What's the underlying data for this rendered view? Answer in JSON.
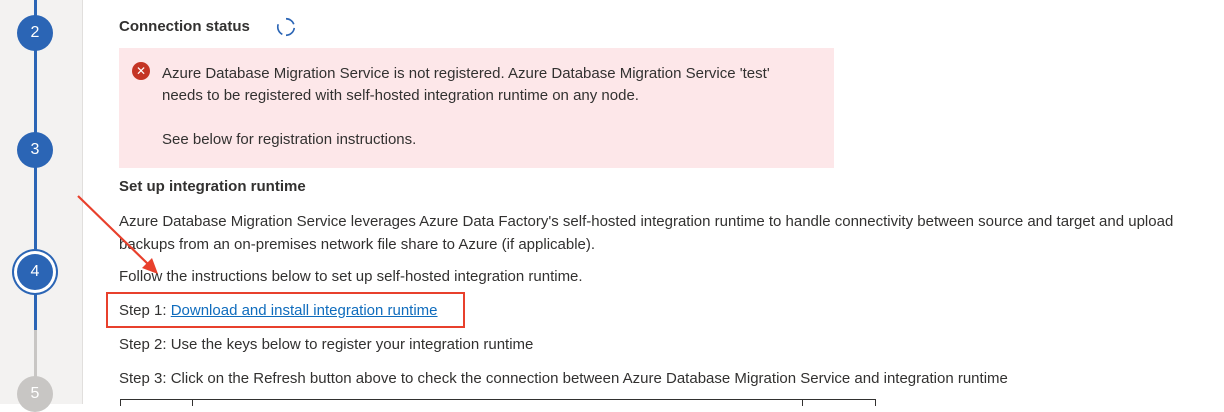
{
  "stepper": {
    "steps": [
      {
        "number": "2",
        "state": "done"
      },
      {
        "number": "3",
        "state": "done"
      },
      {
        "number": "4",
        "state": "current"
      },
      {
        "number": "5",
        "state": "pending"
      }
    ]
  },
  "connection": {
    "title": "Connection status",
    "refresh_icon": "refresh-icon",
    "error_icon": "error-icon",
    "error_line1": "Azure Database Migration Service is not registered. Azure Database Migration Service 'test' needs to be registered with self-hosted integration runtime on any node.",
    "error_line2": "See below for registration instructions."
  },
  "setup": {
    "title": "Set up integration runtime",
    "description": "Azure Database Migration Service leverages Azure Data Factory's self-hosted integration runtime to handle connectivity between source and target and upload backups from an on-premises network file share to Azure (if applicable).",
    "follow": "Follow the instructions below to set up self-hosted integration runtime.",
    "step1_prefix": "Step 1: ",
    "step1_link": "Download and install integration runtime",
    "step2": "Step 2: Use the keys below to register your integration runtime",
    "step3": "Step 3: Click on the Refresh button above to check the connection between Azure Database Migration Service and integration runtime"
  },
  "colors": {
    "accent": "#2b65b5",
    "error_bg": "#fde7e9",
    "error_icon": "#c43525",
    "link": "#0f6cbd",
    "annotation": "#e8402c"
  }
}
